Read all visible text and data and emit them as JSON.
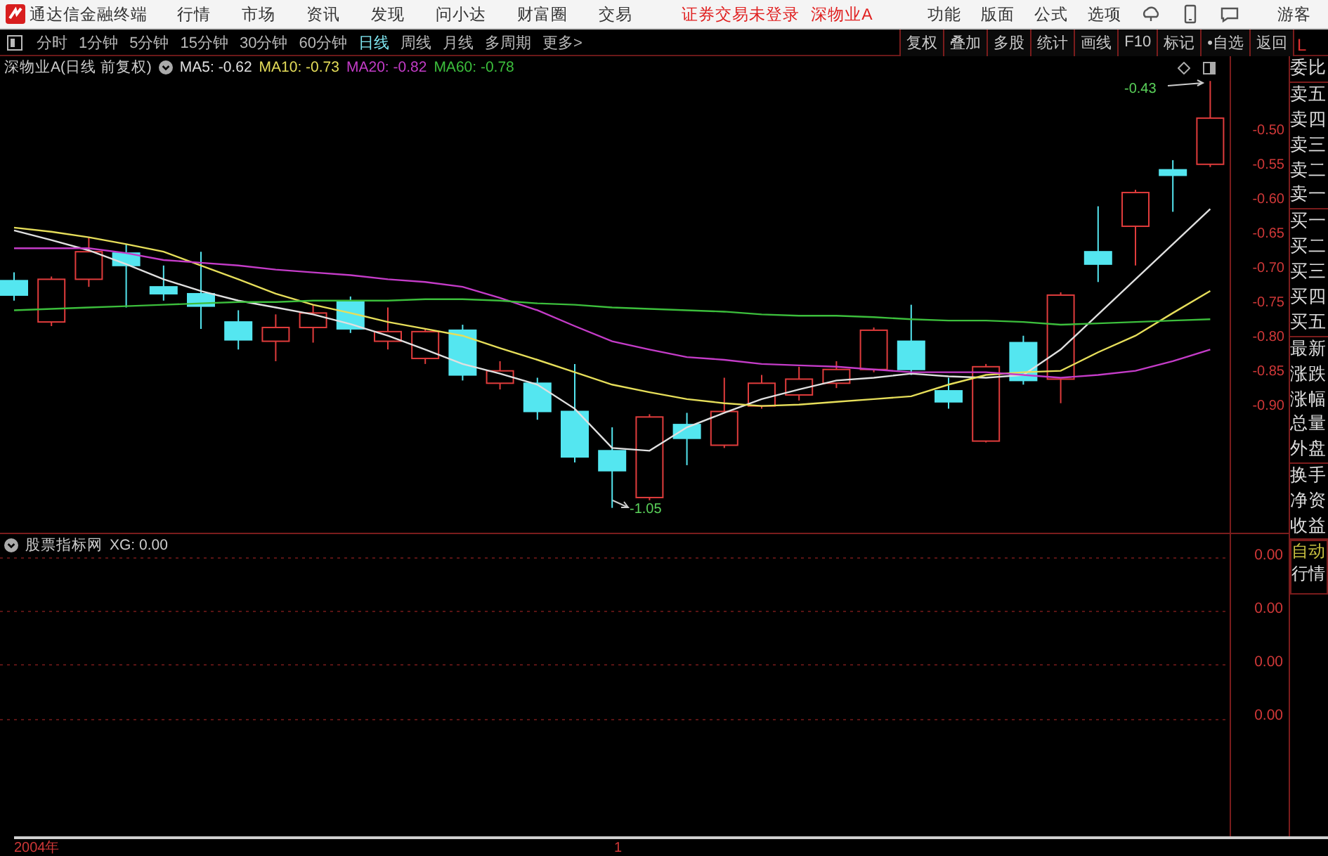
{
  "app": {
    "title": "通达信金融终端",
    "menus": [
      "行情",
      "市场",
      "资讯",
      "发现",
      "问小达",
      "财富圈",
      "交易"
    ],
    "login_status": "证券交易未登录",
    "stock": "深物业A",
    "tools": [
      "功能",
      "版面",
      "公式",
      "选项"
    ],
    "user": "游客"
  },
  "periods": [
    {
      "label": "分时",
      "selected": false
    },
    {
      "label": "1分钟",
      "selected": false
    },
    {
      "label": "5分钟",
      "selected": false
    },
    {
      "label": "15分钟",
      "selected": false
    },
    {
      "label": "30分钟",
      "selected": false
    },
    {
      "label": "60分钟",
      "selected": false
    },
    {
      "label": "日线",
      "selected": true
    },
    {
      "label": "周线",
      "selected": false
    },
    {
      "label": "月线",
      "selected": false
    },
    {
      "label": "多周期",
      "selected": false
    },
    {
      "label": "更多>",
      "selected": false
    }
  ],
  "chart_buttons": [
    "复权",
    "叠加",
    "多股",
    "统计",
    "画线",
    "F10",
    "标记",
    "•自选",
    "返回"
  ],
  "corner_label": "L",
  "legend": {
    "title": "深物业A(日线 前复权)",
    "ma": [
      {
        "label": "MA5: -0.62",
        "color": "#e0e0e0"
      },
      {
        "label": "MA10: -0.73",
        "color": "#e6de5a"
      },
      {
        "label": "MA20: -0.82",
        "color": "#c43cc8"
      },
      {
        "label": "MA60: -0.78",
        "color": "#3cbe3c"
      }
    ]
  },
  "annotations": {
    "high": "-0.43",
    "low": "-1.05"
  },
  "chart_data": {
    "type": "line",
    "ylim": [
      -1.525,
      -0.392
    ],
    "yticks": [
      {
        "value": -0.5,
        "label": "-0.50"
      },
      {
        "value": -0.55,
        "label": "-0.55"
      },
      {
        "value": -0.6,
        "label": "-0.60"
      },
      {
        "value": -0.65,
        "label": "-0.65"
      },
      {
        "value": -0.7,
        "label": "-0.70"
      },
      {
        "value": -0.75,
        "label": "-0.75"
      },
      {
        "value": -0.8,
        "label": "-0.80"
      },
      {
        "value": -0.85,
        "label": "-0.85"
      },
      {
        "value": -0.9,
        "label": "-0.90"
      }
    ],
    "series": [
      {
        "color": "#e0e0e0",
        "values": [
          -0.647,
          -0.661,
          -0.676,
          -0.696,
          -0.718,
          -0.735,
          -0.749,
          -0.759,
          -0.769,
          -0.783,
          -0.8,
          -0.82,
          -0.841,
          -0.855,
          -0.871,
          -0.906,
          -0.963,
          -0.967,
          -0.933,
          -0.912,
          -0.892,
          -0.878,
          -0.865,
          -0.861,
          -0.855,
          -0.859,
          -0.861,
          -0.857,
          -0.82,
          -0.769,
          -0.718,
          -0.667,
          -0.616
        ]
      },
      {
        "color": "#e6de5a",
        "values": [
          -0.643,
          -0.649,
          -0.657,
          -0.667,
          -0.678,
          -0.698,
          -0.718,
          -0.739,
          -0.755,
          -0.767,
          -0.78,
          -0.79,
          -0.8,
          -0.818,
          -0.835,
          -0.853,
          -0.871,
          -0.882,
          -0.892,
          -0.898,
          -0.902,
          -0.9,
          -0.896,
          -0.892,
          -0.888,
          -0.871,
          -0.857,
          -0.853,
          -0.851,
          -0.824,
          -0.8,
          -0.767,
          -0.735
        ]
      },
      {
        "color": "#c43cc8",
        "values": [
          -0.673,
          -0.673,
          -0.673,
          -0.68,
          -0.69,
          -0.694,
          -0.698,
          -0.704,
          -0.708,
          -0.712,
          -0.718,
          -0.722,
          -0.729,
          -0.745,
          -0.763,
          -0.786,
          -0.808,
          -0.82,
          -0.831,
          -0.835,
          -0.841,
          -0.843,
          -0.845,
          -0.849,
          -0.853,
          -0.853,
          -0.853,
          -0.857,
          -0.861,
          -0.857,
          -0.851,
          -0.837,
          -0.82
        ]
      },
      {
        "color": "#3cbe3c",
        "values": [
          -0.763,
          -0.761,
          -0.759,
          -0.757,
          -0.755,
          -0.753,
          -0.751,
          -0.751,
          -0.749,
          -0.749,
          -0.749,
          -0.747,
          -0.747,
          -0.749,
          -0.753,
          -0.755,
          -0.759,
          -0.761,
          -0.763,
          -0.765,
          -0.769,
          -0.771,
          -0.771,
          -0.773,
          -0.776,
          -0.778,
          -0.778,
          -0.78,
          -0.784,
          -0.782,
          -0.78,
          -0.778,
          -0.776
        ]
      }
    ]
  },
  "sidebar": {
    "groups": [
      [
        "委比"
      ],
      [
        "卖五",
        "卖四",
        "卖三",
        "卖二",
        "卖一"
      ],
      [
        "买一",
        "买二",
        "买三",
        "买四",
        "买五"
      ],
      [
        "最新",
        "涨跌",
        "涨幅",
        "总量",
        "外盘"
      ],
      [
        "换手",
        "净资",
        "收益"
      ]
    ],
    "mode": [
      "自动",
      "行情"
    ]
  },
  "indicator": {
    "title": "股票指标网",
    "reading": "XG: 0.00",
    "axis": [
      "0.00",
      "0.00",
      "0.00",
      "0.00"
    ]
  },
  "time_axis": [
    "2004年",
    "1"
  ]
}
